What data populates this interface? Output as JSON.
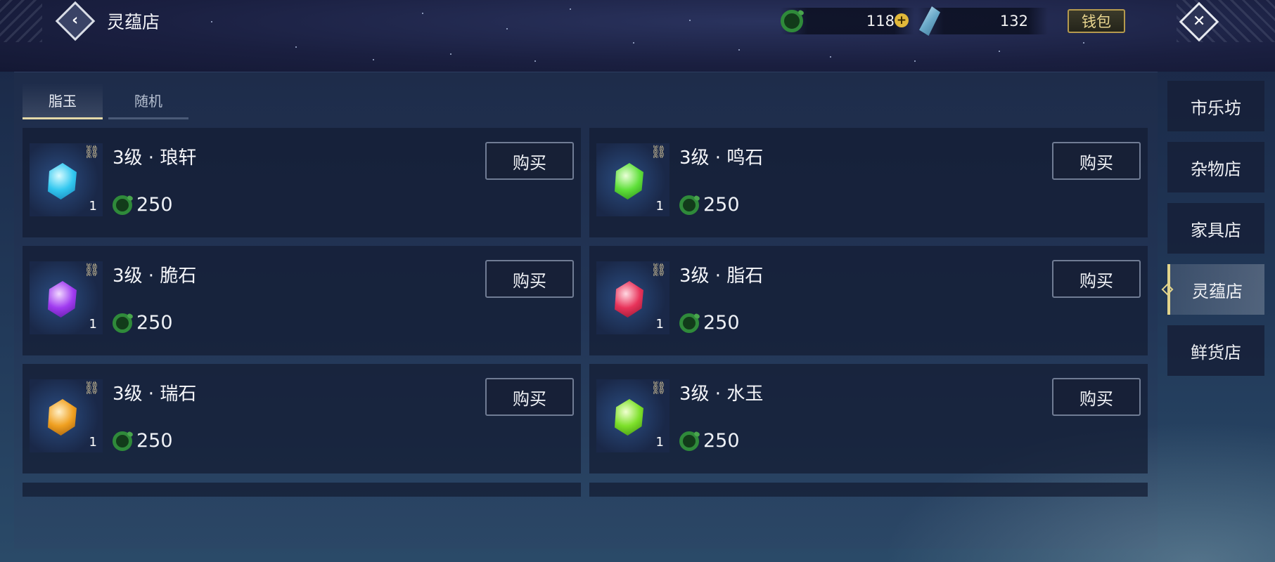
{
  "header": {
    "title": "灵蕴店",
    "currency_jade": "118",
    "currency_crystal": "132",
    "wallet_label": "钱包"
  },
  "tabs": [
    {
      "label": "脂玉",
      "active": true
    },
    {
      "label": "随机",
      "active": false
    }
  ],
  "items": [
    {
      "name": "3级 · 琅轩",
      "count": "1",
      "price": "250",
      "buy_label": "购买",
      "gem_color": "#33c8f0"
    },
    {
      "name": "3级 · 鸣石",
      "count": "1",
      "price": "250",
      "buy_label": "购买",
      "gem_color": "#5fe03a"
    },
    {
      "name": "3级 · 脆石",
      "count": "1",
      "price": "250",
      "buy_label": "购买",
      "gem_color": "#a03bf0"
    },
    {
      "name": "3级 · 脂石",
      "count": "1",
      "price": "250",
      "buy_label": "购买",
      "gem_color": "#e8335a"
    },
    {
      "name": "3级 · 瑞石",
      "count": "1",
      "price": "250",
      "buy_label": "购买",
      "gem_color": "#f0a020"
    },
    {
      "name": "3级 · 水玉",
      "count": "1",
      "price": "250",
      "buy_label": "购买",
      "gem_color": "#7de02a"
    }
  ],
  "nav": [
    {
      "label": "市乐坊",
      "active": false
    },
    {
      "label": "杂物店",
      "active": false
    },
    {
      "label": "家具店",
      "active": false
    },
    {
      "label": "灵蕴店",
      "active": true
    },
    {
      "label": "鲜货店",
      "active": false
    }
  ],
  "icons": {
    "back": "back-chevron-icon",
    "close": "close-x-icon",
    "jade": "jade-coin-icon",
    "crystal": "crystal-icon",
    "plus": "plus-icon",
    "link": "link-chain-icon"
  }
}
